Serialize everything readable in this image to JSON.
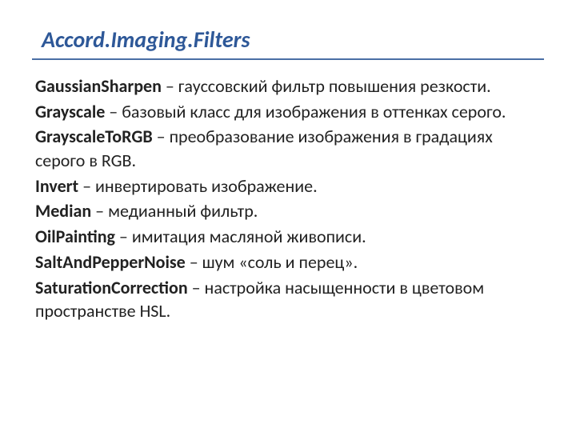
{
  "title": "Accord.Imaging.Filters",
  "items": [
    {
      "term": "GaussianSharpen",
      "desc": " – гауссовский фильтр повышения резкости."
    },
    {
      "term": "Grayscale",
      "desc": " – базовый класс для изображения в оттенках серого."
    },
    {
      "term": "GrayscaleToRGB",
      "desc": " – преобразование изображения в градациях серого в RGB."
    },
    {
      "term": "Invert",
      "desc": " – инвертировать изображение."
    },
    {
      "term": "Median",
      "desc": " – медианный фильтр."
    },
    {
      "term": "OilPainting",
      "desc": " – имитация масляной живописи."
    },
    {
      "term": "SaltAndPepperNoise",
      "desc": " – шум «соль и перец»."
    },
    {
      "term": "SaturationCorrection",
      "desc": " – настройка насыщенности в цветовом пространстве HSL."
    }
  ]
}
